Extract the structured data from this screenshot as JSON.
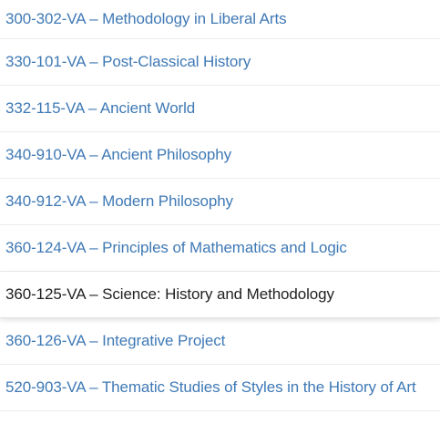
{
  "courses": [
    {
      "label": "300-302-VA – Methodology in Liberal Arts",
      "active": false
    },
    {
      "label": "330-101-VA – Post-Classical History",
      "active": false
    },
    {
      "label": "332-115-VA – Ancient World",
      "active": false
    },
    {
      "label": "340-910-VA – Ancient Philosophy",
      "active": false
    },
    {
      "label": "340-912-VA – Modern Philosophy",
      "active": false
    },
    {
      "label": "360-124-VA – Principles of Mathematics and Logic",
      "active": false
    },
    {
      "label": "360-125-VA – Science: History and Methodology",
      "active": true
    },
    {
      "label": "360-126-VA – Integrative Project",
      "active": false
    },
    {
      "label": "520-903-VA – Thematic Studies of Styles in the History of Art",
      "active": false
    }
  ],
  "colors": {
    "link": "#3f79b5",
    "active_text": "#222222",
    "divider": "#e9ecef"
  }
}
